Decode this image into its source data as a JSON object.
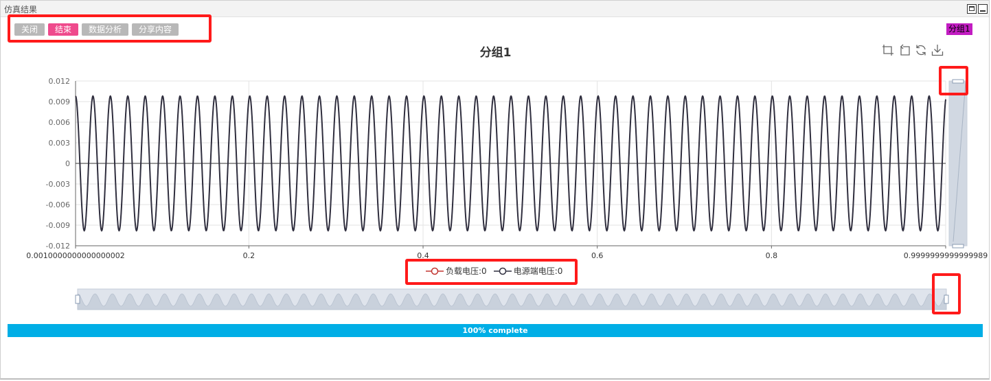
{
  "window": {
    "title": "仿真结果"
  },
  "toolbar": {
    "buttons": [
      {
        "label": "关闭",
        "active": false
      },
      {
        "label": "结束",
        "active": true
      },
      {
        "label": "数据分析",
        "active": false
      },
      {
        "label": "分享内容",
        "active": false
      }
    ]
  },
  "group_badge": "分组1",
  "chart_tools": [
    "zoom-icon",
    "zoom-reset-icon",
    "restore-icon",
    "download-icon"
  ],
  "progress": {
    "value": 1.0,
    "label": "100% complete",
    "color": "#00aee6"
  },
  "chart_data": {
    "type": "line",
    "title": "分组1",
    "xlim": [
      0.0010000000000000002,
      0.9999999999999989
    ],
    "ylim": [
      -0.012,
      0.012
    ],
    "x_tick_labels": [
      "0.0010000000000000002",
      "0.2",
      "0.4",
      "0.6",
      "0.8",
      "0.9999999999999989"
    ],
    "y_tick_labels": [
      "0.012",
      "0.009",
      "0.006",
      "0.003",
      "0",
      "-0.003",
      "-0.006",
      "-0.009",
      "-0.012"
    ],
    "grid": true,
    "legend_position": "bottom-center",
    "series": [
      {
        "name": "负载电压:0",
        "color": "#c23531",
        "values_description": "hidden behind source voltage",
        "amplitude": 0.0098,
        "frequency_hz": 50
      },
      {
        "name": "电源端电压:0",
        "color": "#2f2f3f",
        "amplitude": 0.0098,
        "frequency_hz": 50
      }
    ],
    "data_zoom": {
      "horizontal": {
        "start_fraction": 0.0,
        "end_fraction": 1.0
      },
      "vertical": {
        "start_fraction": 0.0,
        "end_fraction": 1.0
      }
    }
  }
}
